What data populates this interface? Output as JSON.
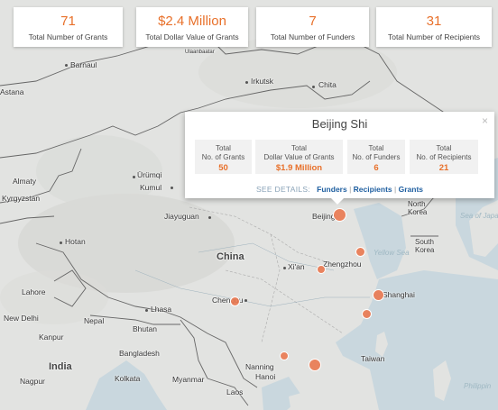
{
  "stats": [
    {
      "value": "71",
      "label": "Total Number of Grants"
    },
    {
      "value": "$2.4 Million",
      "label": "Total Dollar Value of Grants"
    },
    {
      "value": "7",
      "label": "Total Number of Funders"
    },
    {
      "value": "31",
      "label": "Total Number of Recipients"
    }
  ],
  "map": {
    "places": {
      "barnaul": "Barnaul",
      "astana": "Astana",
      "ulaanbaatar": "Ulaanbaatar",
      "irkutsk": "Irkutsk",
      "chita": "Chita",
      "almaty": "Almaty",
      "urumqi": "Ürümqi",
      "kumul": "Kumul",
      "kyrgyzstan": "Kyrgyzstan",
      "jiayuguan": "Jiayuguan",
      "beijing": "Beijing",
      "north_korea": "North Korea",
      "south_korea": "South Korea",
      "sea_of_japan": "Sea of Japa",
      "yellow_sea": "Yellow Sea",
      "hotan": "Hotan",
      "xian": "Xi'an",
      "zhengzhou": "Zhengzhou",
      "china": "China",
      "lahore": "Lahore",
      "chengdu": "Chengdu",
      "shanghai": "Shanghai",
      "new_delhi": "New Delhi",
      "nepal": "Nepal",
      "lhasa": "Lhasa",
      "bhutan": "Bhutan",
      "kanpur": "Kanpur",
      "bangladesh": "Bangladesh",
      "india": "India",
      "nagpur": "Nagpur",
      "kolkata": "Kolkata",
      "myanmar": "Myanmar",
      "nanning": "Nanning",
      "hanoi": "Hanoi",
      "laos": "Laos",
      "taiwan": "Taiwan",
      "philippine_sea": "Philippin"
    }
  },
  "popup": {
    "title": "Beijing Shi",
    "close": "×",
    "cells": [
      {
        "label1": "Total",
        "label2": "No. of Grants",
        "value": "50"
      },
      {
        "label1": "Total",
        "label2": "Dollar Value of Grants",
        "value": "$1.9 Million"
      },
      {
        "label1": "Total",
        "label2": "No. of Funders",
        "value": "6"
      },
      {
        "label1": "Total",
        "label2": "No. of Recipients",
        "value": "21"
      }
    ],
    "see_details": "SEE DETAILS:",
    "links": [
      "Funders",
      "Recipients",
      "Grants"
    ],
    "separator": "|"
  },
  "colors": {
    "accent": "#e8702a",
    "link": "#1f5fa0",
    "water": "#c9d7de",
    "land": "#e3e4e2"
  }
}
